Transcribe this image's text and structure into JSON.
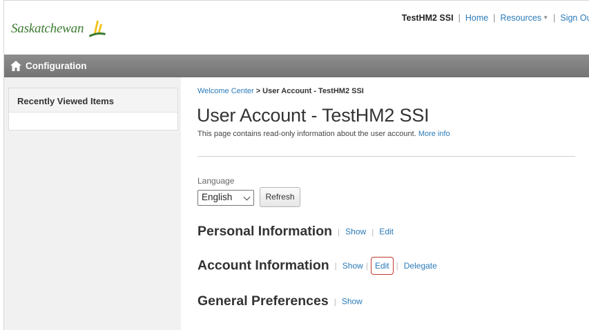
{
  "header": {
    "logo_text": "Saskatchewan",
    "user": "TestHM2 SSI",
    "nav": {
      "home": "Home",
      "resources": "Resources",
      "signout": "Sign Out"
    },
    "logo_colors": {
      "green": "#3c7b30",
      "yellow": "#f2c21b"
    }
  },
  "configbar": {
    "label": "Configuration",
    "icon": "home-icon"
  },
  "sidebar": {
    "recent_title": "Recently Viewed Items"
  },
  "breadcrumb": {
    "link": "Welcome Center",
    "separator": ">",
    "current": "User Account - TestHM2 SSI"
  },
  "page": {
    "title": "User Account - TestHM2 SSI",
    "description": "This page contains read-only information about the user account.",
    "more_info": "More info"
  },
  "language": {
    "label": "Language",
    "selected": "English",
    "refresh": "Refresh"
  },
  "sections": {
    "personal": {
      "title": "Personal Information",
      "show": "Show",
      "edit": "Edit"
    },
    "account": {
      "title": "Account Information",
      "show": "Show",
      "edit": "Edit",
      "delegate": "Delegate"
    },
    "general": {
      "title": "General Preferences",
      "show": "Show"
    }
  },
  "colors": {
    "link": "#2a7ab8",
    "highlight": "#c0392b",
    "configbar": "#808080"
  }
}
